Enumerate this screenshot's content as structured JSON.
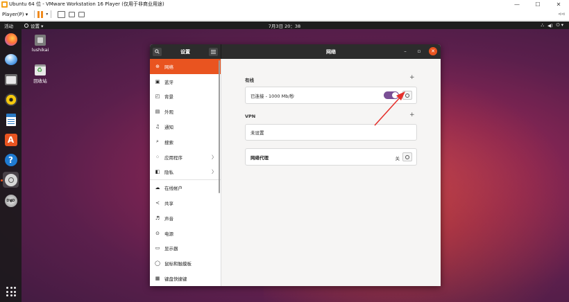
{
  "vm": {
    "title": "Ubuntu 64 位 - VMware Workstation 16 Player (仅用于非商业用途)",
    "player_menu": "Player(P) ▾",
    "toolbar_right": "⊲⊲"
  },
  "topbar": {
    "activities": "活动",
    "app_menu": "设置 ▾",
    "clock": "7月3日 20：38",
    "tray": [
      "⛬",
      "◀)",
      "⏻ ▾"
    ]
  },
  "desktop_icons": [
    {
      "label": "lushikai",
      "icon": "home-folder-icon"
    },
    {
      "label": "回收站",
      "icon": "trash-icon"
    }
  ],
  "dock": [
    "firefox-icon",
    "thunderbird-icon",
    "files-icon",
    "rhythmbox-icon",
    "writer-icon",
    "software-icon",
    "help-icon",
    "settings-icon",
    "dvd-icon"
  ],
  "settings": {
    "sidebar_title": "设置",
    "panel_title": "网络",
    "sidebar_items": [
      {
        "label": "网络",
        "icon": "network-icon",
        "glyph": "⊕",
        "active": true
      },
      {
        "label": "蓝牙",
        "icon": "bluetooth-icon",
        "glyph": "▣"
      },
      {
        "label": "背景",
        "icon": "background-icon",
        "glyph": "◰"
      },
      {
        "label": "外观",
        "icon": "appearance-icon",
        "glyph": "▤"
      },
      {
        "label": "通知",
        "icon": "notification-icon",
        "glyph": "♫"
      },
      {
        "label": "搜索",
        "icon": "search-icon",
        "glyph": "⌕"
      },
      {
        "label": "应用程序",
        "icon": "apps-icon",
        "glyph": "⁘",
        "chevron": "〉"
      },
      {
        "label": "隐私",
        "icon": "privacy-icon",
        "glyph": "◧",
        "chevron": "〉"
      },
      {
        "label": "在线帐户",
        "icon": "online-accounts-icon",
        "glyph": "☁"
      },
      {
        "label": "共享",
        "icon": "sharing-icon",
        "glyph": "≺"
      },
      {
        "label": "声音",
        "icon": "sound-icon",
        "glyph": "♬"
      },
      {
        "label": "电源",
        "icon": "power-icon",
        "glyph": "⊙"
      },
      {
        "label": "显示器",
        "icon": "display-icon",
        "glyph": "▭"
      },
      {
        "label": "鼠标和触摸板",
        "icon": "mouse-icon",
        "glyph": "◯"
      },
      {
        "label": "键盘快捷键",
        "icon": "keyboard-icon",
        "glyph": "▦"
      }
    ],
    "wired": {
      "title": "有线",
      "add": "+",
      "status": "已连接 - 1000 Mb/秒",
      "enabled": true
    },
    "vpn": {
      "title": "VPN",
      "add": "+",
      "status": "未设置"
    },
    "proxy": {
      "title": "网络代理",
      "status": "关"
    }
  },
  "colors": {
    "accent": "#e95420",
    "toggle_on": "#7a4f95",
    "arrow": "#e5302c"
  }
}
